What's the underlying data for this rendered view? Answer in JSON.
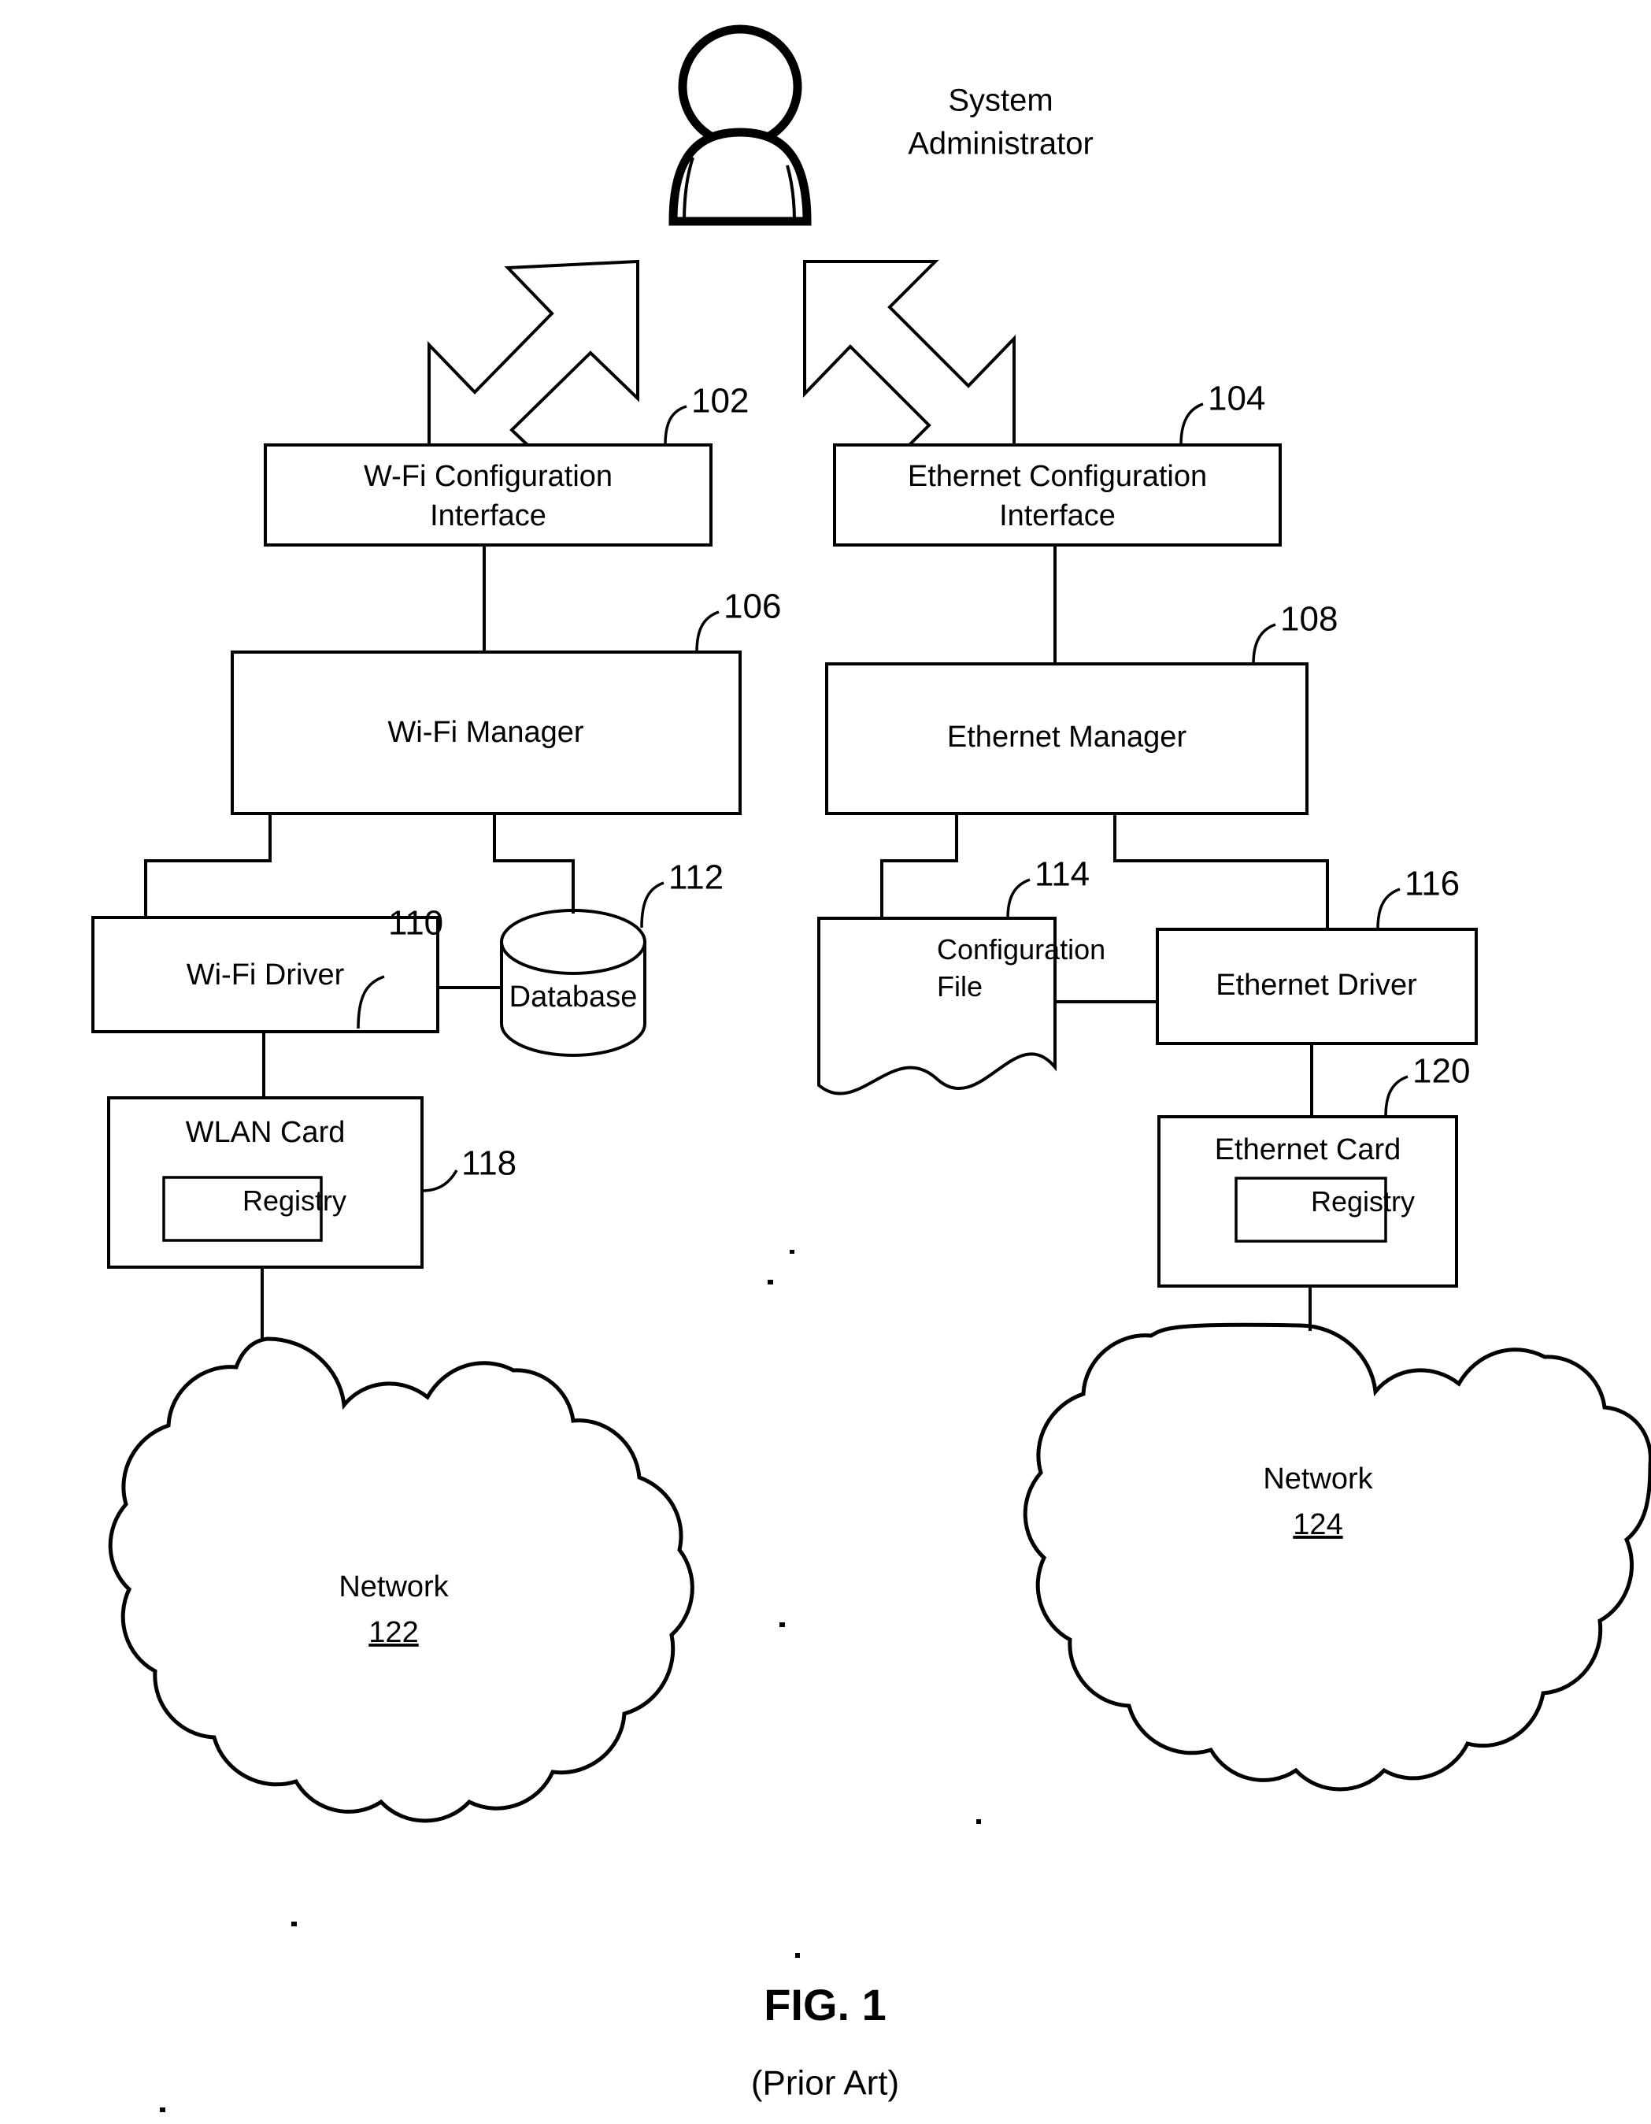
{
  "figure": {
    "title": "FIG. 1",
    "subtitle": "(Prior Art)"
  },
  "actor": {
    "icon": "person-icon",
    "label_line1": "System",
    "label_line2": "Administrator"
  },
  "arrows": {
    "left": "double-headed-arrow-wifi",
    "right": "double-headed-arrow-ethernet"
  },
  "nodes": {
    "wifi_config_interface": {
      "line1": "W-Fi Configuration",
      "line2": "Interface",
      "ref": "102"
    },
    "ethernet_config_interface": {
      "line1": "Ethernet Configuration",
      "line2": "Interface",
      "ref": "104"
    },
    "wifi_manager": {
      "label": "Wi-Fi Manager",
      "ref": "106"
    },
    "ethernet_manager": {
      "label": "Ethernet Manager",
      "ref": "108"
    },
    "wifi_driver": {
      "label": "Wi-Fi Driver",
      "ref": "110"
    },
    "database": {
      "label": "Database",
      "ref": "112"
    },
    "configuration_file": {
      "line1": "Configuration",
      "line2": "File",
      "ref": "114"
    },
    "ethernet_driver": {
      "label": "Ethernet Driver",
      "ref": "116"
    },
    "wlan_card": {
      "label": "WLAN Card",
      "registry": "Registry",
      "ref": "118"
    },
    "ethernet_card": {
      "label": "Ethernet Card",
      "registry": "Registry",
      "ref": "120"
    },
    "network_left": {
      "label": "Network",
      "ref": "122"
    },
    "network_right": {
      "label": "Network",
      "ref": "124"
    }
  },
  "colors": {
    "line": "#000000",
    "background": "#ffffff"
  }
}
